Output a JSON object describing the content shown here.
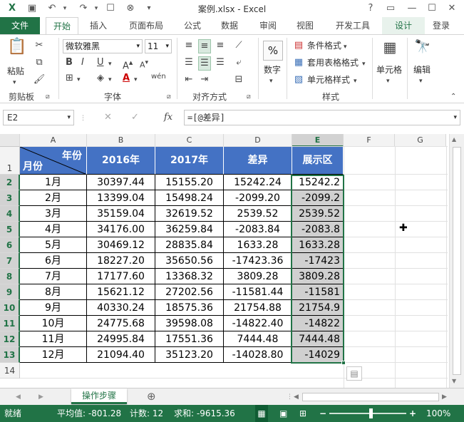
{
  "window": {
    "title": "案例.xlsx - Excel"
  },
  "tabs": {
    "file": "文件",
    "items": [
      "开始",
      "插入",
      "页面布局",
      "公式",
      "数据",
      "审阅",
      "视图",
      "开发工具"
    ],
    "active": "开始",
    "context": "设计",
    "login": "登录"
  },
  "ribbon": {
    "clipboard": {
      "paste": "粘贴",
      "label": "剪贴板"
    },
    "font": {
      "name": "微软雅黑",
      "size": "11",
      "bold": "B",
      "italic": "I",
      "underline": "U",
      "label": "字体",
      "wen": "wén"
    },
    "align": {
      "label": "对齐方式"
    },
    "number": {
      "percent": "%",
      "text": "数字"
    },
    "styles": {
      "cond": "条件格式",
      "table": "套用表格格式",
      "cell": "单元格样式",
      "label": "样式"
    },
    "cells": {
      "text": "单元格"
    },
    "edit": {
      "text": "编辑"
    }
  },
  "formula_bar": {
    "name_box": "E2",
    "fx": "fx",
    "formula": "=[@差异]"
  },
  "columns": [
    "A",
    "B",
    "C",
    "D",
    "E",
    "F",
    "G"
  ],
  "selected_column": "E",
  "table": {
    "header_year": "年份",
    "header_month": "月份",
    "headers": [
      "2016年",
      "2017年",
      "差异",
      "展示区"
    ],
    "rows": [
      {
        "month": "1月",
        "y2016": "30397.44",
        "y2017": "15155.20",
        "diff": "15242.24",
        "show": "15242.2"
      },
      {
        "month": "2月",
        "y2016": "13399.04",
        "y2017": "15498.24",
        "diff": "-2099.20",
        "show": "-2099.2"
      },
      {
        "month": "3月",
        "y2016": "35159.04",
        "y2017": "32619.52",
        "diff": "2539.52",
        "show": "2539.52"
      },
      {
        "month": "4月",
        "y2016": "34176.00",
        "y2017": "36259.84",
        "diff": "-2083.84",
        "show": "-2083.8"
      },
      {
        "month": "5月",
        "y2016": "30469.12",
        "y2017": "28835.84",
        "diff": "1633.28",
        "show": "1633.28"
      },
      {
        "month": "6月",
        "y2016": "18227.20",
        "y2017": "35650.56",
        "diff": "-17423.36",
        "show": "-17423"
      },
      {
        "month": "7月",
        "y2016": "17177.60",
        "y2017": "13368.32",
        "diff": "3809.28",
        "show": "3809.28"
      },
      {
        "month": "8月",
        "y2016": "15621.12",
        "y2017": "27202.56",
        "diff": "-11581.44",
        "show": "-11581"
      },
      {
        "month": "9月",
        "y2016": "40330.24",
        "y2017": "18575.36",
        "diff": "21754.88",
        "show": "21754.9"
      },
      {
        "month": "10月",
        "y2016": "24775.68",
        "y2017": "39598.08",
        "diff": "-14822.40",
        "show": "-14822"
      },
      {
        "month": "11月",
        "y2016": "24995.84",
        "y2017": "17551.36",
        "diff": "7444.48",
        "show": "7444.48"
      },
      {
        "month": "12月",
        "y2016": "21094.40",
        "y2017": "35123.20",
        "diff": "-14028.80",
        "show": "-14029"
      }
    ]
  },
  "row_numbers": [
    "1",
    "2",
    "3",
    "4",
    "5",
    "6",
    "7",
    "8",
    "9",
    "10",
    "11",
    "12",
    "13",
    "14"
  ],
  "sheet": {
    "name": "操作步骤"
  },
  "status": {
    "ready": "就绪",
    "average": "平均值: -801.28",
    "count": "计数: 12",
    "sum": "求和: -9615.36",
    "zoom": "100%"
  },
  "colors": {
    "accent": "#217346",
    "header_fill": "#4472c4",
    "selection_fill": "#d0d0d0"
  }
}
